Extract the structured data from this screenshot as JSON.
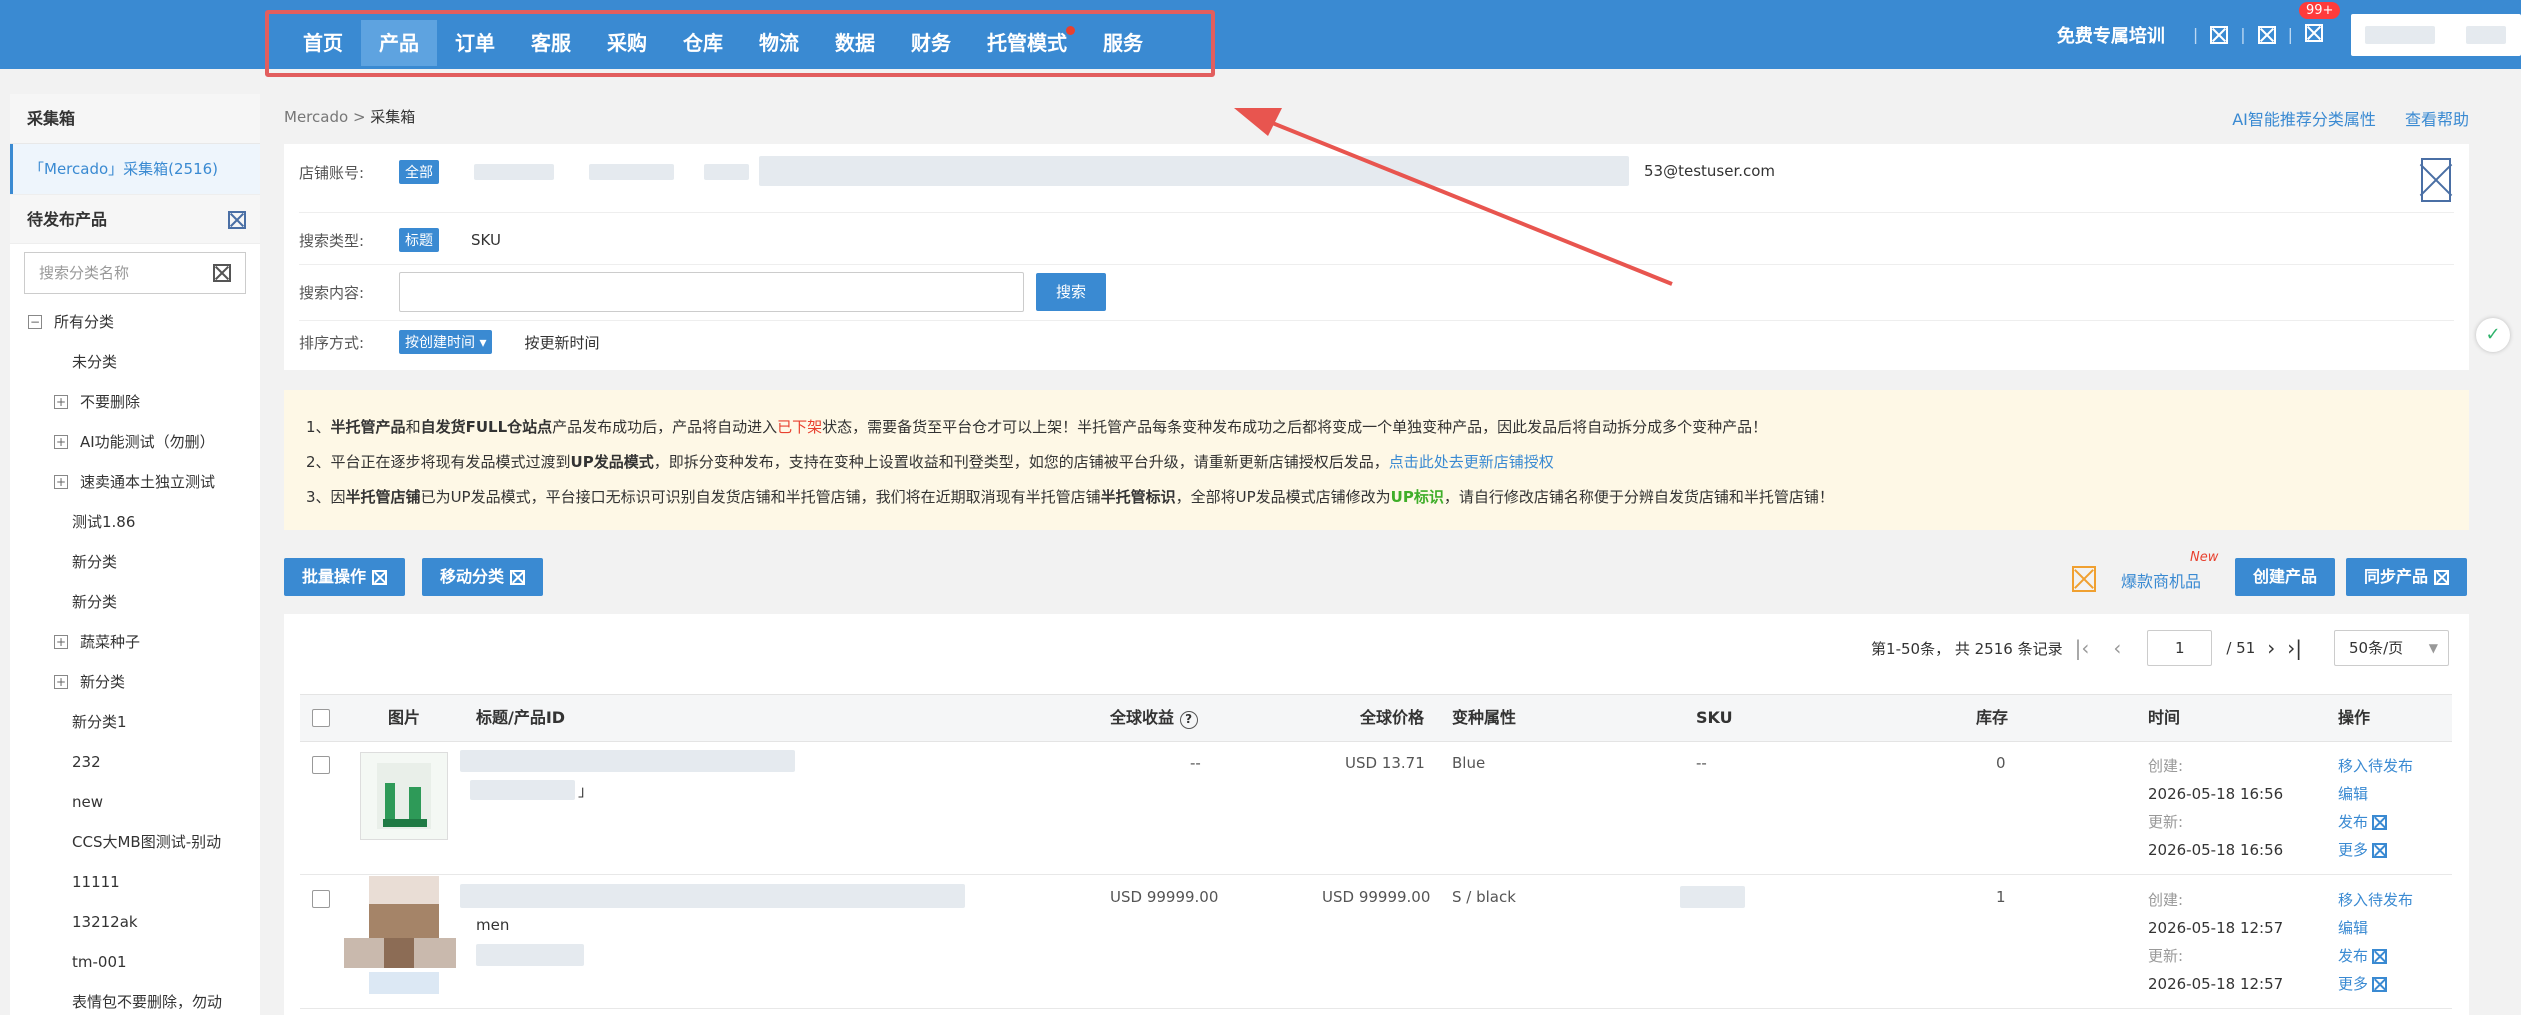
{
  "nav": {
    "items": [
      "首页",
      "产品",
      "订单",
      "客服",
      "采购",
      "仓库",
      "物流",
      "数据",
      "财务",
      "托管模式",
      "服务"
    ],
    "active": "产品",
    "dot_on": "托管模式"
  },
  "topright": {
    "training": "免费专属培训",
    "badge": "99+"
  },
  "sidebar": {
    "title": "采集箱",
    "active_item": "「Mercado」采集箱(2516)",
    "pending_title": "待发布产品",
    "search_placeholder": "搜索分类名称",
    "tree": [
      {
        "label": "所有分类",
        "level": 0,
        "toggle": "−"
      },
      {
        "label": "未分类",
        "level": 1,
        "toggle": ""
      },
      {
        "label": "不要删除",
        "level": 1,
        "toggle": "+"
      },
      {
        "label": "AI功能测试（勿删）",
        "level": 1,
        "toggle": "+"
      },
      {
        "label": "速卖通本土独立测试",
        "level": 1,
        "toggle": "+"
      },
      {
        "label": "测试1.86",
        "level": 1,
        "toggle": ""
      },
      {
        "label": "新分类",
        "level": 1,
        "toggle": ""
      },
      {
        "label": "新分类",
        "level": 1,
        "toggle": ""
      },
      {
        "label": "蔬菜种子",
        "level": 1,
        "toggle": "+"
      },
      {
        "label": "新分类",
        "level": 1,
        "toggle": "+"
      },
      {
        "label": "新分类1",
        "level": 1,
        "toggle": ""
      },
      {
        "label": "232",
        "level": 1,
        "toggle": ""
      },
      {
        "label": "new",
        "level": 1,
        "toggle": ""
      },
      {
        "label": "CCS大MB图测试-别动",
        "level": 1,
        "toggle": ""
      },
      {
        "label": "11111",
        "level": 1,
        "toggle": ""
      },
      {
        "label": "13212ak",
        "level": 1,
        "toggle": ""
      },
      {
        "label": "tm-001",
        "level": 1,
        "toggle": ""
      },
      {
        "label": "表情包不要删除，勿动",
        "level": 1,
        "toggle": ""
      }
    ]
  },
  "breadcrumb": {
    "root": "Mercado",
    "sep": ">",
    "current": "采集箱"
  },
  "toplinks": {
    "ai": "AI智能推荐分类属性",
    "help": "查看帮助"
  },
  "filter": {
    "store_label": "店铺账号:",
    "store_all": "全部",
    "store_email": "53@testuser.com",
    "type_label": "搜索类型:",
    "type_active": "标题",
    "type_other": "SKU",
    "content_label": "搜索内容:",
    "search_btn": "搜索",
    "sort_label": "排序方式:",
    "sort_active": "按创建时间 ▾",
    "sort_other": "按更新时间"
  },
  "notice": {
    "l1_a": "1、",
    "l1_b": "半托管产品",
    "l1_c": "和",
    "l1_d": "自发货FULL仓站点",
    "l1_e": "产品发布成功后，产品将自动进入",
    "l1_f": "已下架",
    "l1_g": "状态，需要备货至平台仓才可以上架！半托管产品每条变种发布成功之后都将变成一个单独变种产品，因此发品后将自动拆分成多个变种产品！",
    "l2_a": "2、平台正在逐步将现有发品模式过渡到",
    "l2_b": "UP发品模式",
    "l2_c": "，即拆分变种发布，支持在变种上设置收益和刊登类型，如您的店铺被平台升级，请重新更新店铺授权后发品，",
    "l2_d": "点击此处去更新店铺授权",
    "l3_a": "3、因",
    "l3_b": "半托管店铺",
    "l3_c": "已为UP发品模式，平台接口无标识可识别自发货店铺和半托管店铺，我们将在近期取消现有半托管店铺",
    "l3_d": "半托管标识",
    "l3_e": "，全部将UP发品模式店铺修改为",
    "l3_f": "UP标识",
    "l3_g": "，请自行修改店铺名称便于分辨自发货店铺和半托管店铺！"
  },
  "actions": {
    "batch": "批量操作",
    "move": "移动分类",
    "hot": "爆款商机品",
    "new_tag": "New",
    "create": "创建产品",
    "sync": "同步产品"
  },
  "pager": {
    "summary": "第1-50条，  共 2516 条记录",
    "page": "1",
    "total": "/ 51",
    "per": "50条/页"
  },
  "table": {
    "headers": {
      "img": "图片",
      "title": "标题/产品ID",
      "profit": "全球收益",
      "price": "全球价格",
      "variant": "变种属性",
      "sku": "SKU",
      "stock": "库存",
      "time": "时间",
      "ops": "操作"
    },
    "rows": [
      {
        "sub": "」",
        "profit": "--",
        "price": "USD 13.71",
        "variant": "Blue",
        "sku": "--",
        "stock": "0",
        "created_label": "创建:",
        "created": "2026-05-18 16:56",
        "updated_label": "更新:",
        "updated": "2026-05-18 16:56"
      },
      {
        "sub": "men",
        "profit": "USD 99999.00",
        "price": "USD 99999.00",
        "variant": "S / black",
        "sku": "",
        "stock": "1",
        "created_label": "创建:",
        "created": "2026-05-18 12:57",
        "updated_label": "更新:",
        "updated": "2026-05-18 12:57"
      }
    ],
    "ops": {
      "move": "移入待发布",
      "edit": "编辑",
      "publish": "发布",
      "more": "更多"
    }
  }
}
